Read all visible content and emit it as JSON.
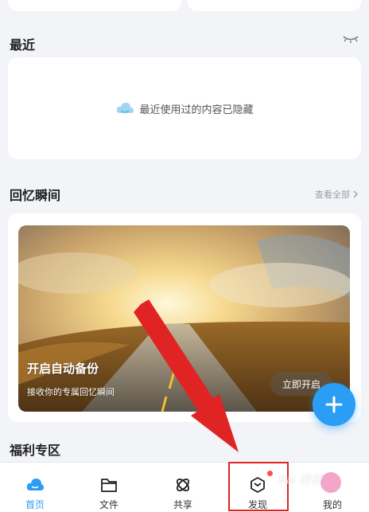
{
  "recent": {
    "title": "最近",
    "hidden_text": "最近使用过的内容已隐藏",
    "eye_icon": "eye-closed-icon"
  },
  "memories": {
    "title": "回忆瞬间",
    "see_all": "查看全部",
    "card_title": "开启自动备份",
    "card_subtitle": "接收你的专属回忆瞬间",
    "open_button": "立即开启"
  },
  "welfare": {
    "title": "福利专区"
  },
  "fab": {
    "icon": "plus-icon"
  },
  "tabs": [
    {
      "label": "首页",
      "icon": "cloud-icon",
      "active": true
    },
    {
      "label": "文件",
      "icon": "folder-icon",
      "active": false
    },
    {
      "label": "共享",
      "icon": "share-icon",
      "active": false
    },
    {
      "label": "发现",
      "icon": "discover-icon",
      "active": false,
      "badge": true
    },
    {
      "label": "我的",
      "icon": "avatar-icon",
      "active": false
    }
  ],
  "watermark": "Bai 经验",
  "colors": {
    "accent": "#2a9df4",
    "annotation_red": "#e02424",
    "background": "#f2f4f8"
  }
}
